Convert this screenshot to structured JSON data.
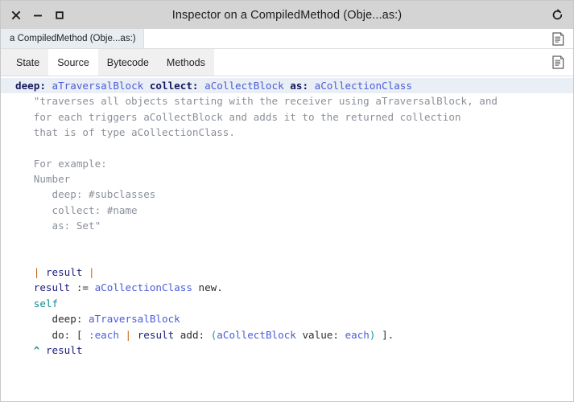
{
  "window": {
    "title": "Inspector on a CompiledMethod (Obje...as:)",
    "controls": [
      {
        "name": "close-button",
        "glyph": "x"
      },
      {
        "name": "minimize-button",
        "glyph": "-"
      },
      {
        "name": "maximize-button",
        "glyph": "square"
      }
    ],
    "right_icon": "history-refresh-icon"
  },
  "object_bar": {
    "tab_label": "a CompiledMethod (Obje...as:)",
    "icon": "page-icon"
  },
  "tab_bar": {
    "tabs": [
      {
        "label": "State",
        "selected": false
      },
      {
        "label": "Source",
        "selected": true
      },
      {
        "label": "Bytecode",
        "selected": false
      },
      {
        "label": "Methods",
        "selected": false
      }
    ],
    "icon": "page-icon"
  },
  "colors": {
    "titlebar_bg": "#d4d4d4",
    "object_tab_bg": "#e8edf2",
    "tabstrip_bg": "#f0f0f0",
    "selected_tab_bg": "#ffffff",
    "code_highlight_bg": "#eaeff6",
    "keyword": "#17175e",
    "argument": "#4a5cd8",
    "comment": "#8a9099",
    "variable": "#1b1b7a",
    "pipe": "#c26a1c",
    "self": "#0f8e8e",
    "paren": "#17988a"
  },
  "code": {
    "lines": [
      {
        "highlight": true,
        "tokens": [
          {
            "t": "deep:",
            "c": "kw"
          },
          {
            "t": " ",
            "c": "plain"
          },
          {
            "t": "aTraversalBlock",
            "c": "arg"
          },
          {
            "t": " ",
            "c": "plain"
          },
          {
            "t": "collect:",
            "c": "kw"
          },
          {
            "t": " ",
            "c": "plain"
          },
          {
            "t": "aCollectBlock",
            "c": "arg"
          },
          {
            "t": " ",
            "c": "plain"
          },
          {
            "t": "as:",
            "c": "kw"
          },
          {
            "t": " ",
            "c": "plain"
          },
          {
            "t": "aCollectionClass",
            "c": "arg"
          }
        ]
      },
      {
        "highlight": false,
        "tokens": [
          {
            "t": "   \"traverses all objects starting with the receiver using aTraversalBlock, and",
            "c": "comment"
          }
        ]
      },
      {
        "highlight": false,
        "tokens": [
          {
            "t": "   for each triggers aCollectBlock and adds it to the returned collection",
            "c": "comment"
          }
        ]
      },
      {
        "highlight": false,
        "tokens": [
          {
            "t": "   that is of type aCollectionClass.",
            "c": "comment"
          }
        ]
      },
      {
        "highlight": false,
        "tokens": [
          {
            "t": "",
            "c": "plain"
          }
        ]
      },
      {
        "highlight": false,
        "tokens": [
          {
            "t": "   For example:",
            "c": "comment"
          }
        ]
      },
      {
        "highlight": false,
        "tokens": [
          {
            "t": "   Number",
            "c": "comment"
          }
        ]
      },
      {
        "highlight": false,
        "tokens": [
          {
            "t": "      deep: #subclasses",
            "c": "comment"
          }
        ]
      },
      {
        "highlight": false,
        "tokens": [
          {
            "t": "      collect: #name",
            "c": "comment"
          }
        ]
      },
      {
        "highlight": false,
        "tokens": [
          {
            "t": "      as: Set\"",
            "c": "comment"
          }
        ]
      },
      {
        "highlight": false,
        "tokens": [
          {
            "t": "",
            "c": "plain"
          }
        ]
      },
      {
        "highlight": false,
        "tokens": [
          {
            "t": "",
            "c": "plain"
          }
        ]
      },
      {
        "highlight": false,
        "tokens": [
          {
            "t": "   ",
            "c": "plain"
          },
          {
            "t": "|",
            "c": "pipe"
          },
          {
            "t": " ",
            "c": "plain"
          },
          {
            "t": "result",
            "c": "var"
          },
          {
            "t": " ",
            "c": "plain"
          },
          {
            "t": "|",
            "c": "pipe"
          }
        ]
      },
      {
        "highlight": false,
        "tokens": [
          {
            "t": "   ",
            "c": "plain"
          },
          {
            "t": "result",
            "c": "var"
          },
          {
            "t": " := ",
            "c": "plain"
          },
          {
            "t": "aCollectionClass",
            "c": "arg"
          },
          {
            "t": " new.",
            "c": "plain"
          }
        ]
      },
      {
        "highlight": false,
        "tokens": [
          {
            "t": "   ",
            "c": "plain"
          },
          {
            "t": "self",
            "c": "self"
          }
        ]
      },
      {
        "highlight": false,
        "tokens": [
          {
            "t": "      deep: ",
            "c": "plain"
          },
          {
            "t": "aTraversalBlock",
            "c": "arg"
          }
        ]
      },
      {
        "highlight": false,
        "tokens": [
          {
            "t": "      do: [ ",
            "c": "plain"
          },
          {
            "t": ":each",
            "c": "arg"
          },
          {
            "t": " ",
            "c": "plain"
          },
          {
            "t": "|",
            "c": "pipe"
          },
          {
            "t": " ",
            "c": "plain"
          },
          {
            "t": "result",
            "c": "var"
          },
          {
            "t": " add: ",
            "c": "plain"
          },
          {
            "t": "(",
            "c": "paren"
          },
          {
            "t": "aCollectBlock",
            "c": "arg"
          },
          {
            "t": " value: ",
            "c": "plain"
          },
          {
            "t": "each",
            "c": "arg"
          },
          {
            "t": ")",
            "c": "paren"
          },
          {
            "t": " ].",
            "c": "plain"
          }
        ]
      },
      {
        "highlight": false,
        "tokens": [
          {
            "t": "   ",
            "c": "plain"
          },
          {
            "t": "^",
            "c": "caret"
          },
          {
            "t": " ",
            "c": "plain"
          },
          {
            "t": "result",
            "c": "var"
          }
        ]
      }
    ]
  }
}
